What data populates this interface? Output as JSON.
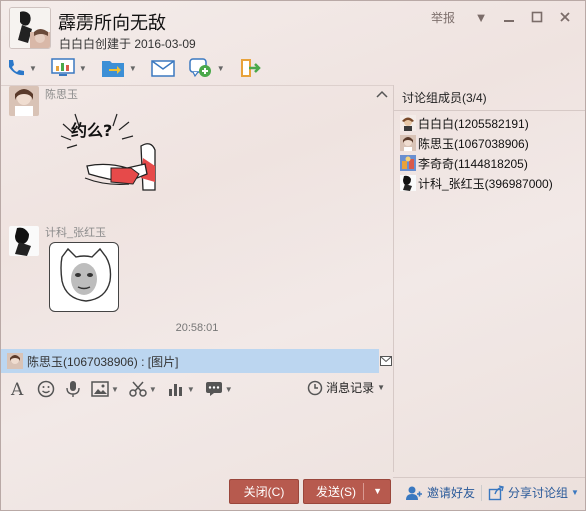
{
  "header": {
    "title": "霹雳所向无敌",
    "subtitle": "白白白创建于 2016-03-09",
    "report_label": "举报"
  },
  "toolbar": {
    "items": [
      {
        "icon": "phone-icon"
      },
      {
        "icon": "screen-share-icon"
      },
      {
        "icon": "file-transfer-icon"
      },
      {
        "icon": "mail-icon"
      },
      {
        "icon": "add-app-icon"
      },
      {
        "icon": "exit-group-icon"
      }
    ]
  },
  "chat": {
    "messages": [
      {
        "sender": "陈思玉",
        "content": "sticker",
        "sticker_text": "约么?"
      },
      {
        "sender": "计科_张红玉",
        "content": "sticker"
      }
    ],
    "time": "20:58:01"
  },
  "preview": {
    "text": "陈思玉(1067038906) : [图片]"
  },
  "input_toolbar": {
    "history_label": "消息记录"
  },
  "buttons": {
    "close_label": "关闭(C)",
    "send_label": "发送(S)"
  },
  "side": {
    "title": "讨论组成员(3/4)",
    "members": [
      {
        "name": "白白白(1205582191)"
      },
      {
        "name": "陈思玉(1067038906)"
      },
      {
        "name": "李奇奇(1144818205)"
      },
      {
        "name": "计科_张红玉(396987000)"
      }
    ],
    "invite_label": "邀请好友",
    "share_label": "分享讨论组"
  },
  "colors": {
    "accent_button": "#b75a4e",
    "preview_bar": "#bcd6f0",
    "link_blue": "#2a5a9a"
  }
}
